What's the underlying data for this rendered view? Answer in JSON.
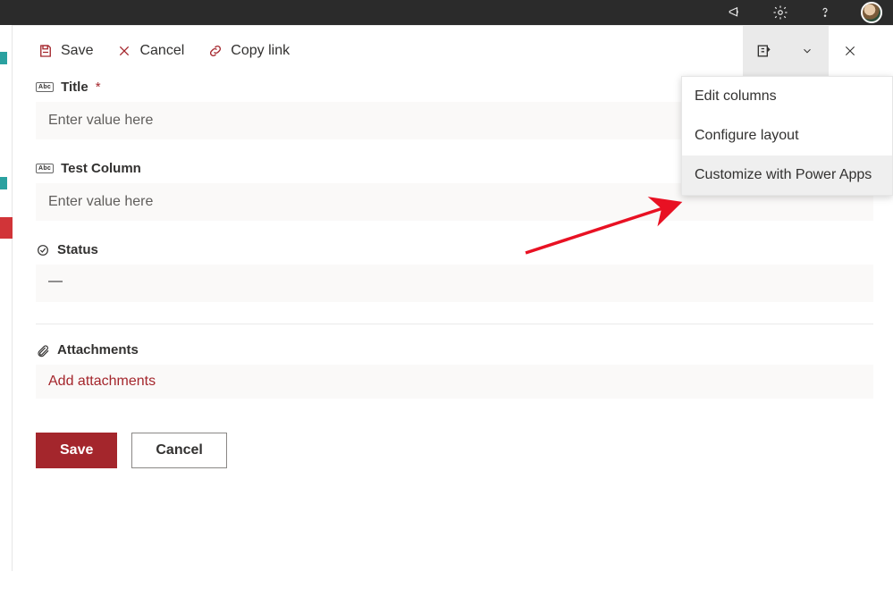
{
  "toolbar": {
    "save_label": "Save",
    "cancel_label": "Cancel",
    "copy_link_label": "Copy link"
  },
  "form": {
    "fields": {
      "title": {
        "label": "Title",
        "placeholder": "Enter value here",
        "required": "*"
      },
      "test_column": {
        "label": "Test Column",
        "placeholder": "Enter value here"
      },
      "status": {
        "label": "Status",
        "value": "—"
      },
      "attachments": {
        "label": "Attachments",
        "add_label": "Add attachments"
      }
    }
  },
  "footer": {
    "save": "Save",
    "cancel": "Cancel"
  },
  "dropdown": {
    "items": [
      {
        "label": "Edit columns"
      },
      {
        "label": "Configure layout"
      },
      {
        "label": "Customize with Power Apps"
      }
    ]
  }
}
